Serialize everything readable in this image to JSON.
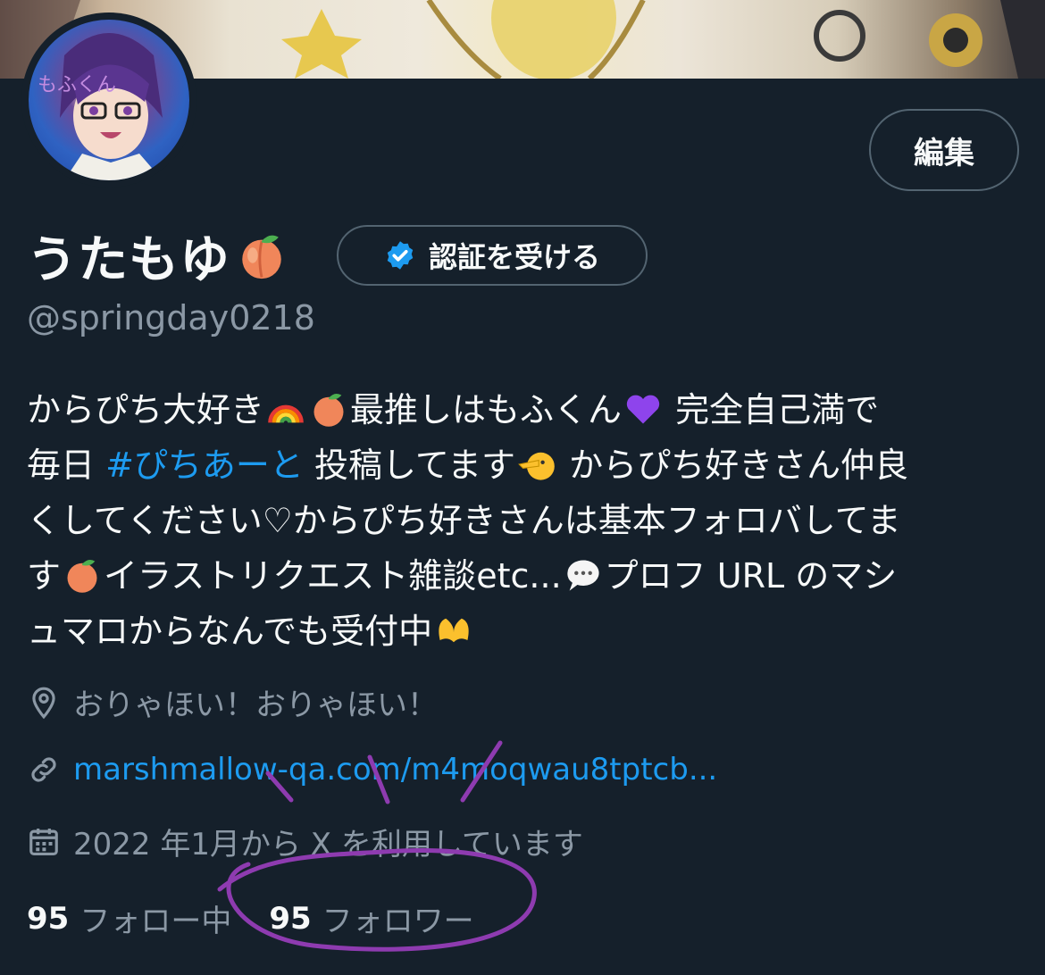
{
  "profile": {
    "display_name": "うたもゆ",
    "verify_label": "認証を受ける",
    "edit_label": "編集",
    "handle": "@springday0218"
  },
  "bio": {
    "l1a": "からぴち大好き",
    "l1b": "最推しはもふくん",
    "l1c": " 完全自己満で",
    "l2a": "毎日 ",
    "l2hashtag": "#ぴちあーと",
    "l2b": " 投稿してます",
    "l2c": " からぴち好きさん仲良",
    "l3": "くしてください♡からぴち好きさんは基本フォロバしてま",
    "l4a": "す",
    "l4b": "イラストリクエスト雑談etc...",
    "l4c": "プロフ URL のマシ",
    "l5": "ュマロからなんでも受付中"
  },
  "meta": {
    "location": "おりゃほい！おりゃほい！",
    "link": "marshmallow-qa.com/m4moqwau8tptcb...",
    "joined": "2022 年1月から X を利用しています"
  },
  "stats": {
    "following_count": "95",
    "following_label": "フォロー中",
    "followers_count": "95",
    "followers_label": "フォロワー"
  },
  "icons": [
    "location-pin-icon",
    "link-icon",
    "calendar-icon",
    "verified-badge-icon",
    "peach-emoji",
    "rainbow-emoji",
    "purple-heart-emoji",
    "pointing-face-emoji",
    "speech-bubble-emoji",
    "heart-hands-emoji"
  ],
  "colors": {
    "background": "#15202b",
    "accent": "#1d9bf0",
    "muted": "#8b98a5",
    "annotation": "#8e3bb0"
  }
}
